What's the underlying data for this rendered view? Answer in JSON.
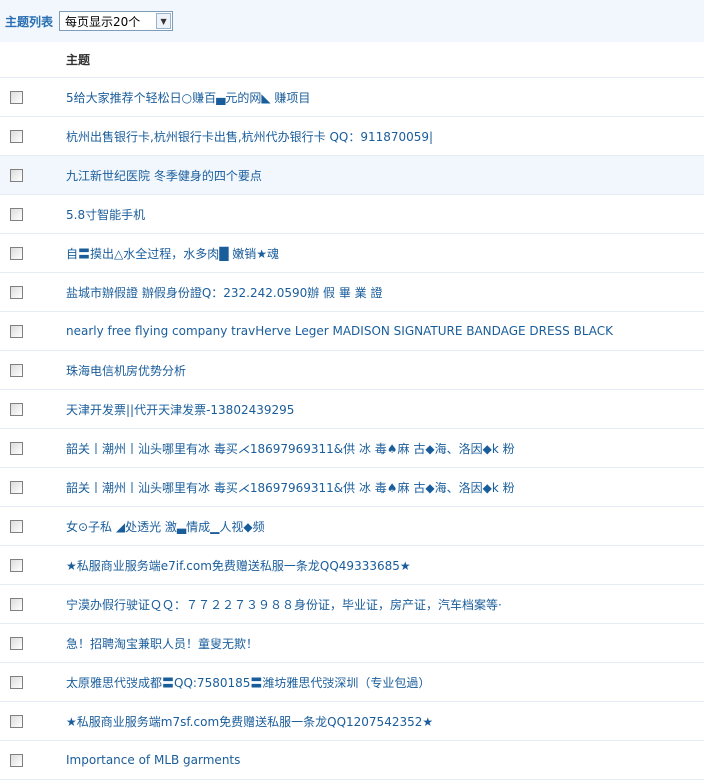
{
  "toolbar": {
    "title": "主题列表",
    "page_size_select": "每页显示20个"
  },
  "table": {
    "header": "主题",
    "rows": [
      {
        "title": "5给大家推荐个轻松日○赚百▄元的网◣ 赚项目"
      },
      {
        "title": "杭州出售银行卡,杭州银行卡出售,杭州代办银行卡 QQ：911870059|"
      },
      {
        "title": "九江新世纪医院 冬季健身的四个要点"
      },
      {
        "title": "5.8寸智能手机"
      },
      {
        "title": "自〓摸出△水全过程，水多肉█ 嫩销★魂"
      },
      {
        "title": "盐城市辦假證 辦假身份證Q：232.242.0590辦 假 畢 業 證"
      },
      {
        "title": "nearly free flying company travHerve Leger MADISON SIGNATURE BANDAGE DRESS BLACK"
      },
      {
        "title": "珠海电信机房优势分析"
      },
      {
        "title": "天津开发票||代开天津发票-13802439295"
      },
      {
        "title": "韶关丨潮州丨汕头哪里有冰 毒买⋌18697969311&供 冰 毒♠麻 古◆海、洛因◆k 粉"
      },
      {
        "title": "韶关丨潮州丨汕头哪里有冰 毒买⋌18697969311&供 冰 毒♠麻 古◆海、洛因◆k 粉"
      },
      {
        "title": "女⊙子私 ◢处透光 激▃情成▁人视◆频"
      },
      {
        "title": "★私服商业服务端e7if.com免费赠送私服一条龙QQ49333685★"
      },
      {
        "title": "宁漠办假行驶证ＱＱ：７７２２７３９８８身份证，毕业证，房产证，汽车档案等·"
      },
      {
        "title": "急！招聘淘宝兼职人员！童叟无欺！"
      },
      {
        "title": "太原雅思代弢成都〓QQ:7580185〓潍坊雅思代弢深圳（专业包過）"
      },
      {
        "title": "★私服商业服务端m7sf.com免费赠送私服一条龙QQ1207542352★"
      },
      {
        "title": "Importance of MLB garments"
      }
    ]
  },
  "colors": {
    "link": "#1a5d9b",
    "toolbar_title": "#2a6fb2",
    "highlight_row": "#f1f7fd",
    "separator": "#e4edf5"
  }
}
